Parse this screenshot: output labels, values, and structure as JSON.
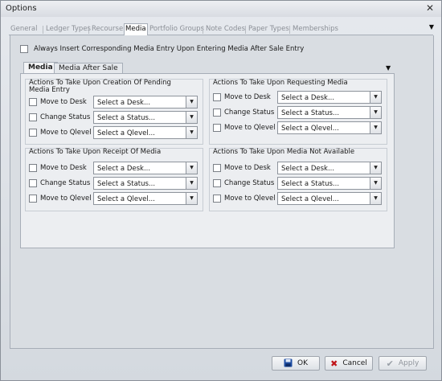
{
  "window": {
    "title": "Options",
    "close_glyph": "✕"
  },
  "tabs": [
    {
      "label": "General"
    },
    {
      "label": "Ledger Types"
    },
    {
      "label": "Recourse"
    },
    {
      "label": "Media"
    },
    {
      "label": "Portfolio Groups"
    },
    {
      "label": "Note Codes"
    },
    {
      "label": "Paper Types"
    },
    {
      "label": "Memberships"
    }
  ],
  "active_tab": "Media",
  "top_checkbox": {
    "label": "Always Insert Corresponding Media Entry Upon Entering Media After Sale Entry",
    "checked": false
  },
  "inner_tabs": [
    {
      "label": "Media"
    },
    {
      "label": "Media After Sale"
    }
  ],
  "groups": [
    {
      "title": "Actions To Take Upon Creation Of Pending Media Entry",
      "rows": [
        {
          "label": "Move to Desk",
          "value": "Select a Desk..."
        },
        {
          "label": "Change Status",
          "value": "Select a Status..."
        },
        {
          "label": "Move to Qlevel",
          "value": "Select a Qlevel..."
        }
      ]
    },
    {
      "title": "Actions To Take Upon Requesting Media",
      "rows": [
        {
          "label": "Move to Desk",
          "value": "Select a Desk..."
        },
        {
          "label": "Change Status",
          "value": "Select a Status..."
        },
        {
          "label": "Move to Qlevel",
          "value": "Select a Qlevel..."
        }
      ]
    },
    {
      "title": "Actions To Take Upon Receipt Of Media",
      "rows": [
        {
          "label": "Move to Desk",
          "value": "Select a Desk..."
        },
        {
          "label": "Change Status",
          "value": "Select a Status..."
        },
        {
          "label": "Move to Qlevel",
          "value": "Select a Qlevel..."
        }
      ]
    },
    {
      "title": "Actions To Take Upon Media Not Available",
      "rows": [
        {
          "label": "Move to Desk",
          "value": "Select a Desk..."
        },
        {
          "label": "Change Status",
          "value": "Select a Status..."
        },
        {
          "label": "Move to Qlevel",
          "value": "Select a Qlevel..."
        }
      ]
    }
  ],
  "buttons": {
    "ok": {
      "label": "OK",
      "icon": "save-icon"
    },
    "cancel": {
      "label": "Cancel",
      "icon": "cancel-icon"
    },
    "apply": {
      "label": "Apply",
      "icon": "checkmark-icon",
      "enabled": false
    }
  },
  "colors": {
    "save_icon": "#1f4ea3",
    "cancel_icon": "#c0161b",
    "apply_icon": "#9aa0a8"
  }
}
